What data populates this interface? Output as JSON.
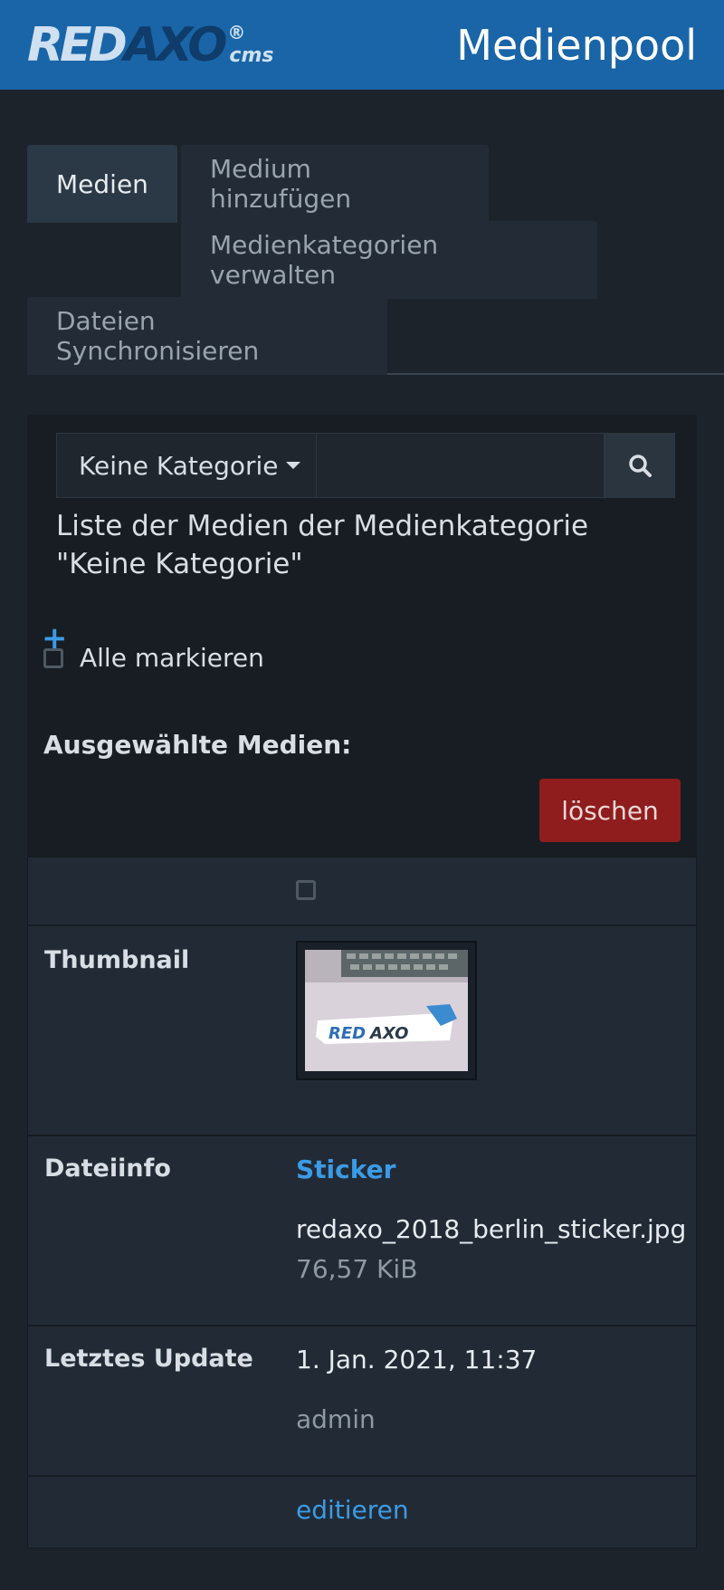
{
  "header": {
    "logo_red": "RED",
    "logo_axo": "AXO",
    "logo_reg": "®",
    "logo_cms": "cms",
    "page_title": "Medienpool"
  },
  "tabs": [
    {
      "label": "Medien",
      "active": true
    },
    {
      "label": "Medium hinzufügen",
      "active": false
    },
    {
      "label": "Medienkategorien verwalten",
      "active": false
    },
    {
      "label": "Dateien Synchronisieren",
      "active": false
    }
  ],
  "filter": {
    "category": "Keine Kategorie",
    "search_value": "",
    "search_icon": "search-icon"
  },
  "list_caption": "Liste der Medien der Medienkategorie \"Keine Kategorie\"",
  "mark_all_label": "Alle markieren",
  "selected_media_label": "Ausgewählte Medien:",
  "delete_label": "löschen",
  "media": {
    "thumbnail_label": "Thumbnail",
    "fileinfo_label": "Dateiinfo",
    "title": "Sticker",
    "filename": "redaxo_2018_berlin_sticker.jpg",
    "filesize": "76,57 KiB",
    "last_update_label": "Letztes Update",
    "updated": "1. Jan. 2021, 11:37",
    "user": "admin",
    "edit_label": "editieren"
  },
  "colors": {
    "header_bg": "#1965a8",
    "accent": "#3b9be6",
    "danger": "#8f1d1d",
    "page_bg": "#1c232b"
  }
}
